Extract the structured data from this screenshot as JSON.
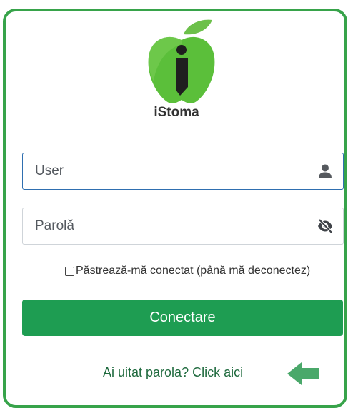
{
  "brand": {
    "name": "iStoma",
    "logo_icon": "apple-i-logo-icon",
    "logo_color": "#5bbf3a"
  },
  "login": {
    "user_placeholder": "User",
    "user_icon": "user-icon",
    "password_placeholder": "Parolă",
    "password_icon": "eye-slash-icon",
    "remember_label": "Păstrează-mă conectat (până mă deconectez)",
    "remember_checked": false,
    "submit_label": "Conectare",
    "forgot_link": "Ai uitat parola? Click aici",
    "forgot_arrow_icon": "arrow-left-icon"
  },
  "colors": {
    "frame_border": "#37a34a",
    "button_bg": "#1e9d52",
    "link": "#1f6a3e",
    "arrow": "#4aa86a"
  }
}
